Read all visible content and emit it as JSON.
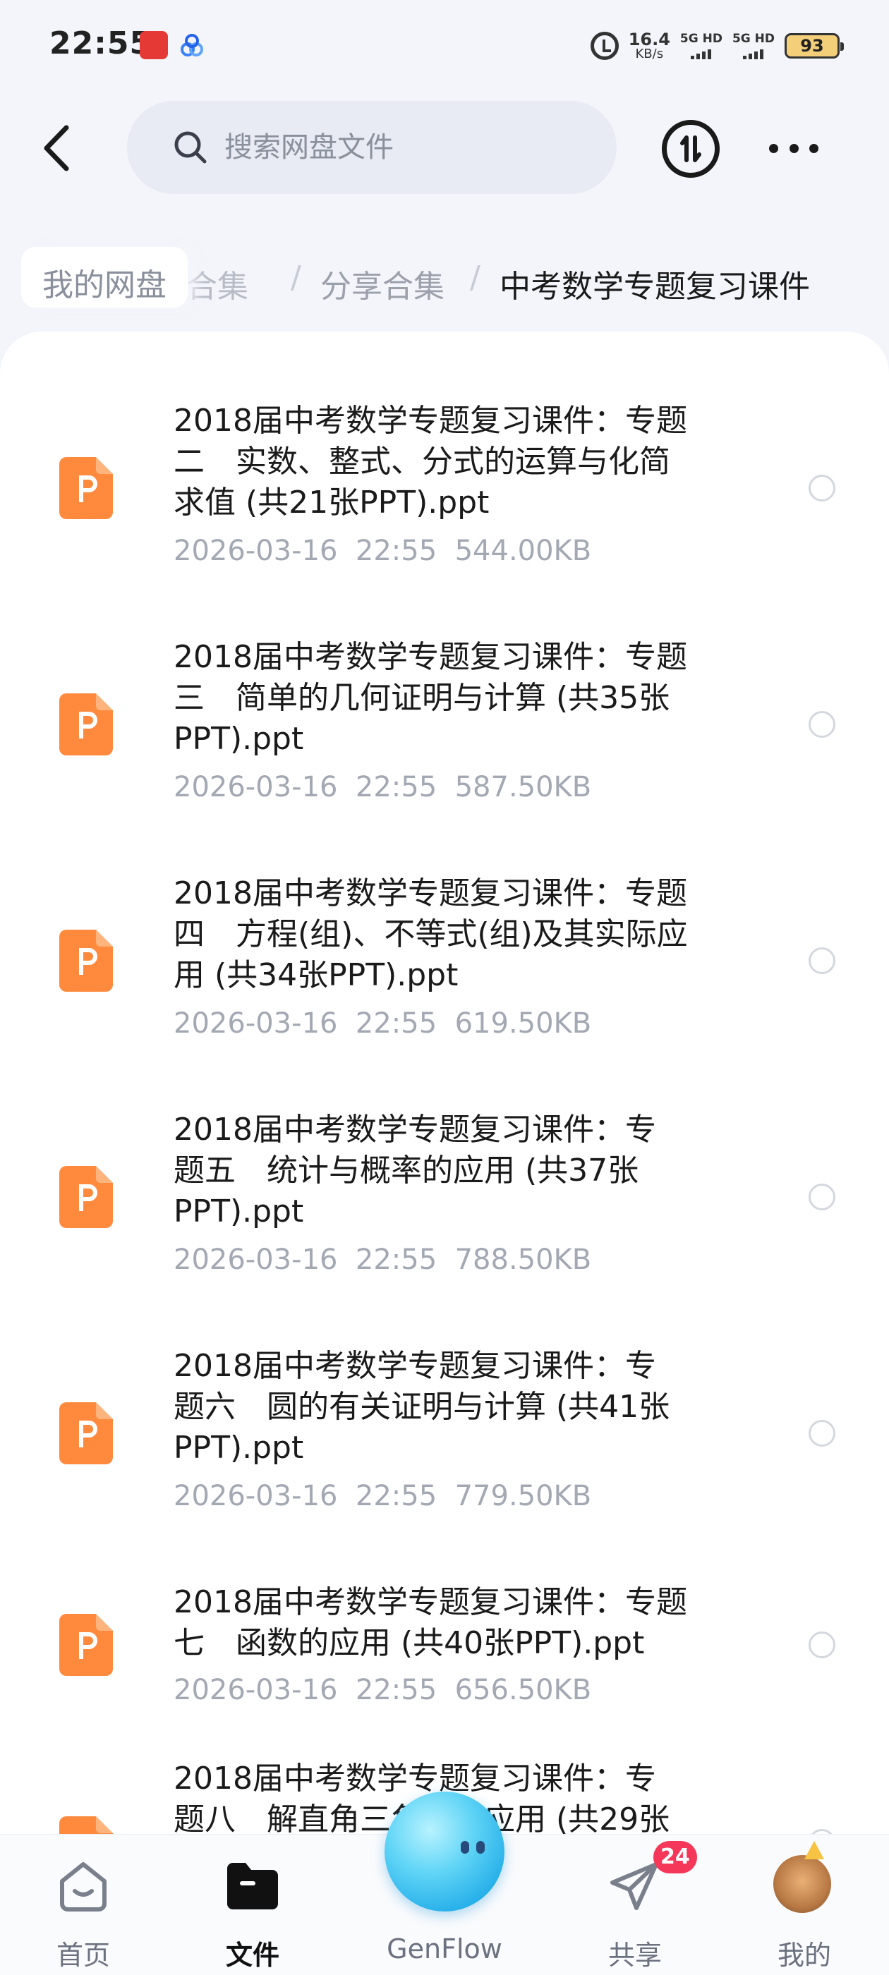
{
  "status_bar": {
    "time": "22:55",
    "net_speed_value": "16.4",
    "net_speed_unit": "KB/s",
    "signal1_label": "5G HD",
    "signal2_label": "5G HD",
    "battery": "93"
  },
  "header": {
    "search_placeholder": "搜索网盘文件"
  },
  "breadcrumb": {
    "items": [
      "我的网盘",
      "合集",
      "分享合集",
      "中考数学专题复习课件"
    ],
    "separator": "/"
  },
  "files": [
    {
      "name": "2018届中考数学专题复习课件：专题\n二　实数、整式、分式的运算与化简\n求值 (共21张PPT).ppt",
      "meta": "2026-03-16  22:55  544.00KB"
    },
    {
      "name": "2018届中考数学专题复习课件：专题\n三　简单的几何证明与计算 (共35张\nPPT).ppt",
      "meta": "2026-03-16  22:55  587.50KB"
    },
    {
      "name": "2018届中考数学专题复习课件：专题\n四　方程(组)、不等式(组)及其实际应\n用 (共34张PPT).ppt",
      "meta": "2026-03-16  22:55  619.50KB"
    },
    {
      "name": "2018届中考数学专题复习课件：专\n题五　统计与概率的应用 (共37张\nPPT).ppt",
      "meta": "2026-03-16  22:55  788.50KB"
    },
    {
      "name": "2018届中考数学专题复习课件：专\n题六　圆的有关证明与计算 (共41张\nPPT).ppt",
      "meta": "2026-03-16  22:55  779.50KB"
    },
    {
      "name": "2018届中考数学专题复习课件：专题\n七　函数的应用 (共40张PPT).ppt",
      "meta": "2026-03-16  22:55  656.50KB"
    },
    {
      "name": "2018届中考数学专题复习课件：专\n题八　解直角三角形的应用 (共29张",
      "meta": ""
    }
  ],
  "bottom_nav": {
    "home": "首页",
    "files": "文件",
    "genflow": "GenFlow",
    "share": "共享",
    "mine": "我的",
    "share_badge": "24"
  },
  "colors": {
    "accent_orange": "#ff8a3d",
    "badge_red": "#f5385a",
    "genflow_blue": "#1aa7e6"
  }
}
